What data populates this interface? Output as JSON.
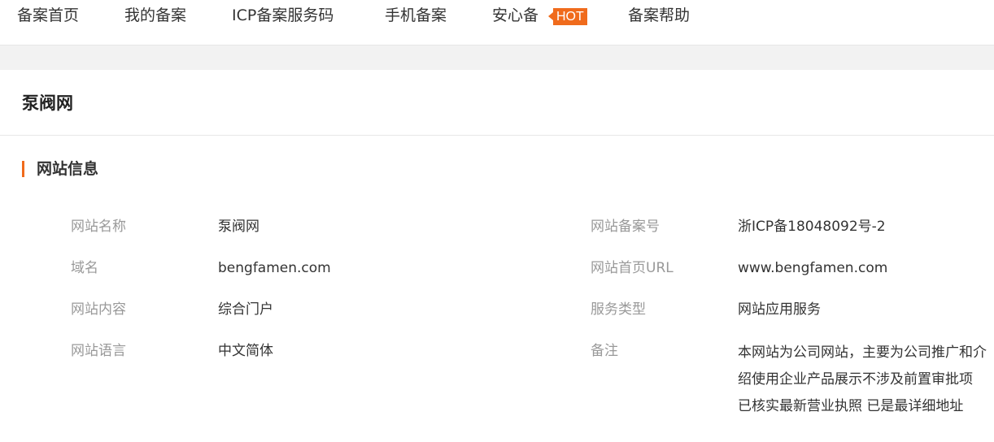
{
  "nav": {
    "items": [
      {
        "label": "备案首页"
      },
      {
        "label": "我的备案"
      },
      {
        "label": "ICP备案服务码"
      },
      {
        "label": "手机备案"
      },
      {
        "label": "安心备"
      },
      {
        "label": "备案帮助"
      }
    ],
    "hot_badge": "HOT"
  },
  "site": {
    "title": "泵阀网"
  },
  "section": {
    "title": "网站信息"
  },
  "info": {
    "left": [
      {
        "label": "网站名称",
        "value": "泵阀网"
      },
      {
        "label": "域名",
        "value": "bengfamen.com"
      },
      {
        "label": "网站内容",
        "value": "综合门户"
      },
      {
        "label": "网站语言",
        "value": "中文简体"
      }
    ],
    "right": [
      {
        "label": "网站备案号",
        "value": "浙ICP备18048092号-2"
      },
      {
        "label": "网站首页URL",
        "value": "www.bengfamen.com"
      },
      {
        "label": "服务类型",
        "value": "网站应用服务"
      },
      {
        "label": "备注",
        "value": "本网站为公司网站，主要为公司推广和介绍使用企业产品展示不涉及前置审批项 已核实最新营业执照 已是最详细地址"
      }
    ]
  },
  "colors": {
    "accent": "#f06b1c",
    "label_gray": "#999999",
    "text": "#333333",
    "band_gray": "#f2f2f2"
  }
}
